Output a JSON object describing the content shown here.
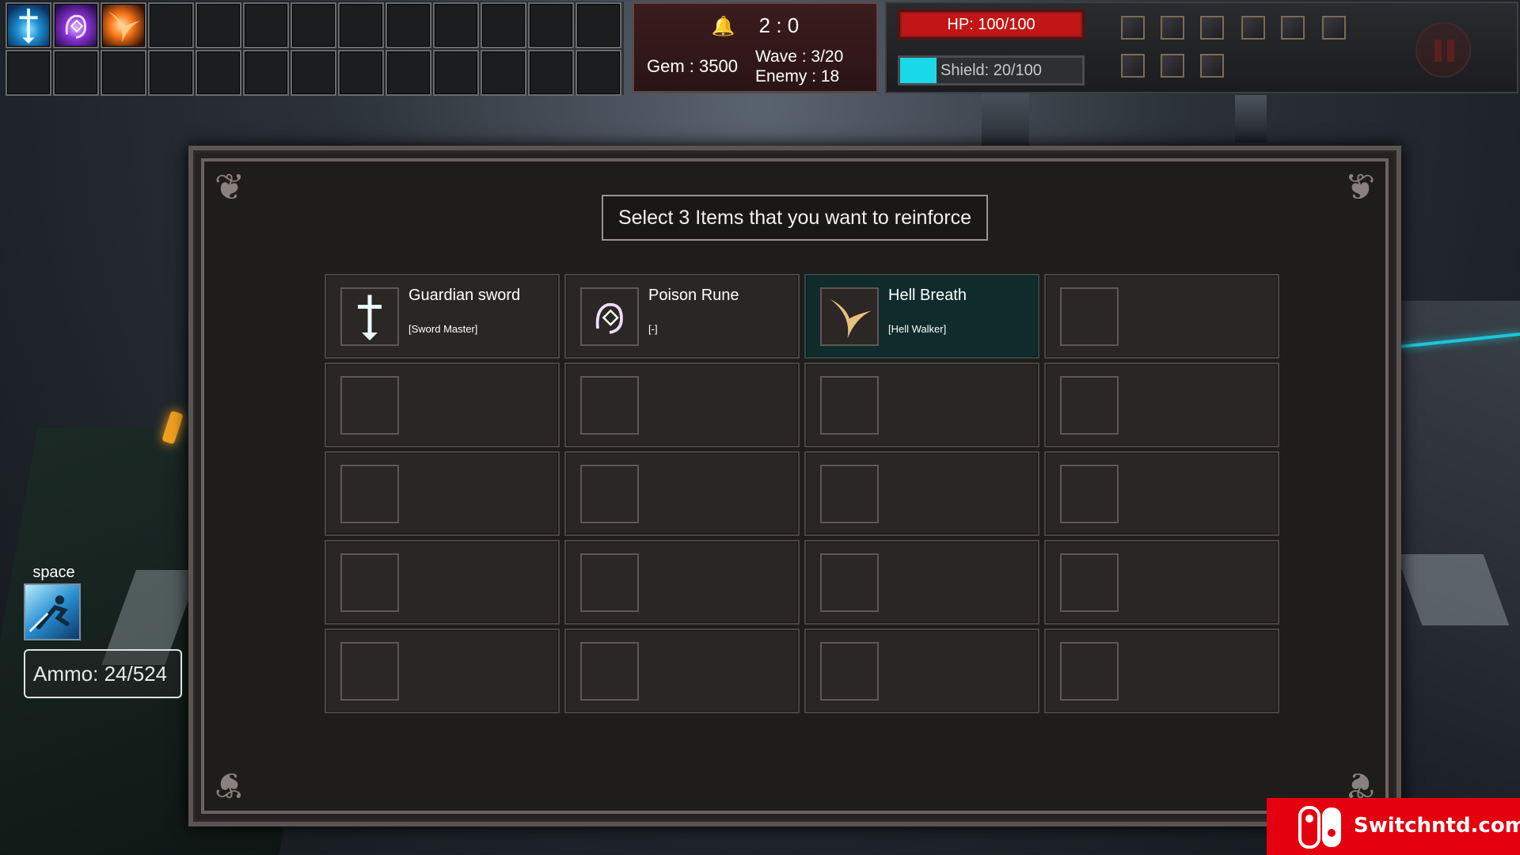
{
  "hud": {
    "score": "2 : 0",
    "gem": "Gem : 3500",
    "wave": "Wave : 3/20",
    "enemy": "Enemy : 18",
    "hp": "HP: 100/100",
    "shield": "Shield: 20/100",
    "shield_fraction": 0.2
  },
  "inventory": {
    "slots": [
      "guardian-sword",
      "poison-rune",
      "hell-breath"
    ],
    "total_slots": 26
  },
  "dialog": {
    "title": "Select 3 Items that you want to reinforce",
    "items": [
      {
        "name": "Guardian sword",
        "tag": "[Sword Master]",
        "icon": "guardian-sword-icon"
      },
      {
        "name": "Poison Rune",
        "tag": "[-]",
        "icon": "poison-rune-icon"
      },
      {
        "name": "Hell Breath",
        "tag": "[Hell Walker]",
        "icon": "hell-breath-icon",
        "selected": true
      }
    ],
    "total_cells": 20
  },
  "skill": {
    "key": "space",
    "icon": "dash-skill-icon"
  },
  "ammo": "Ammo: 24/524",
  "watermark": "Switchntd.com",
  "colors": {
    "hp": "#c01616",
    "shield": "#19d9e8",
    "selected_cell": "#0f2b2b",
    "watermark": "#e4000f"
  }
}
